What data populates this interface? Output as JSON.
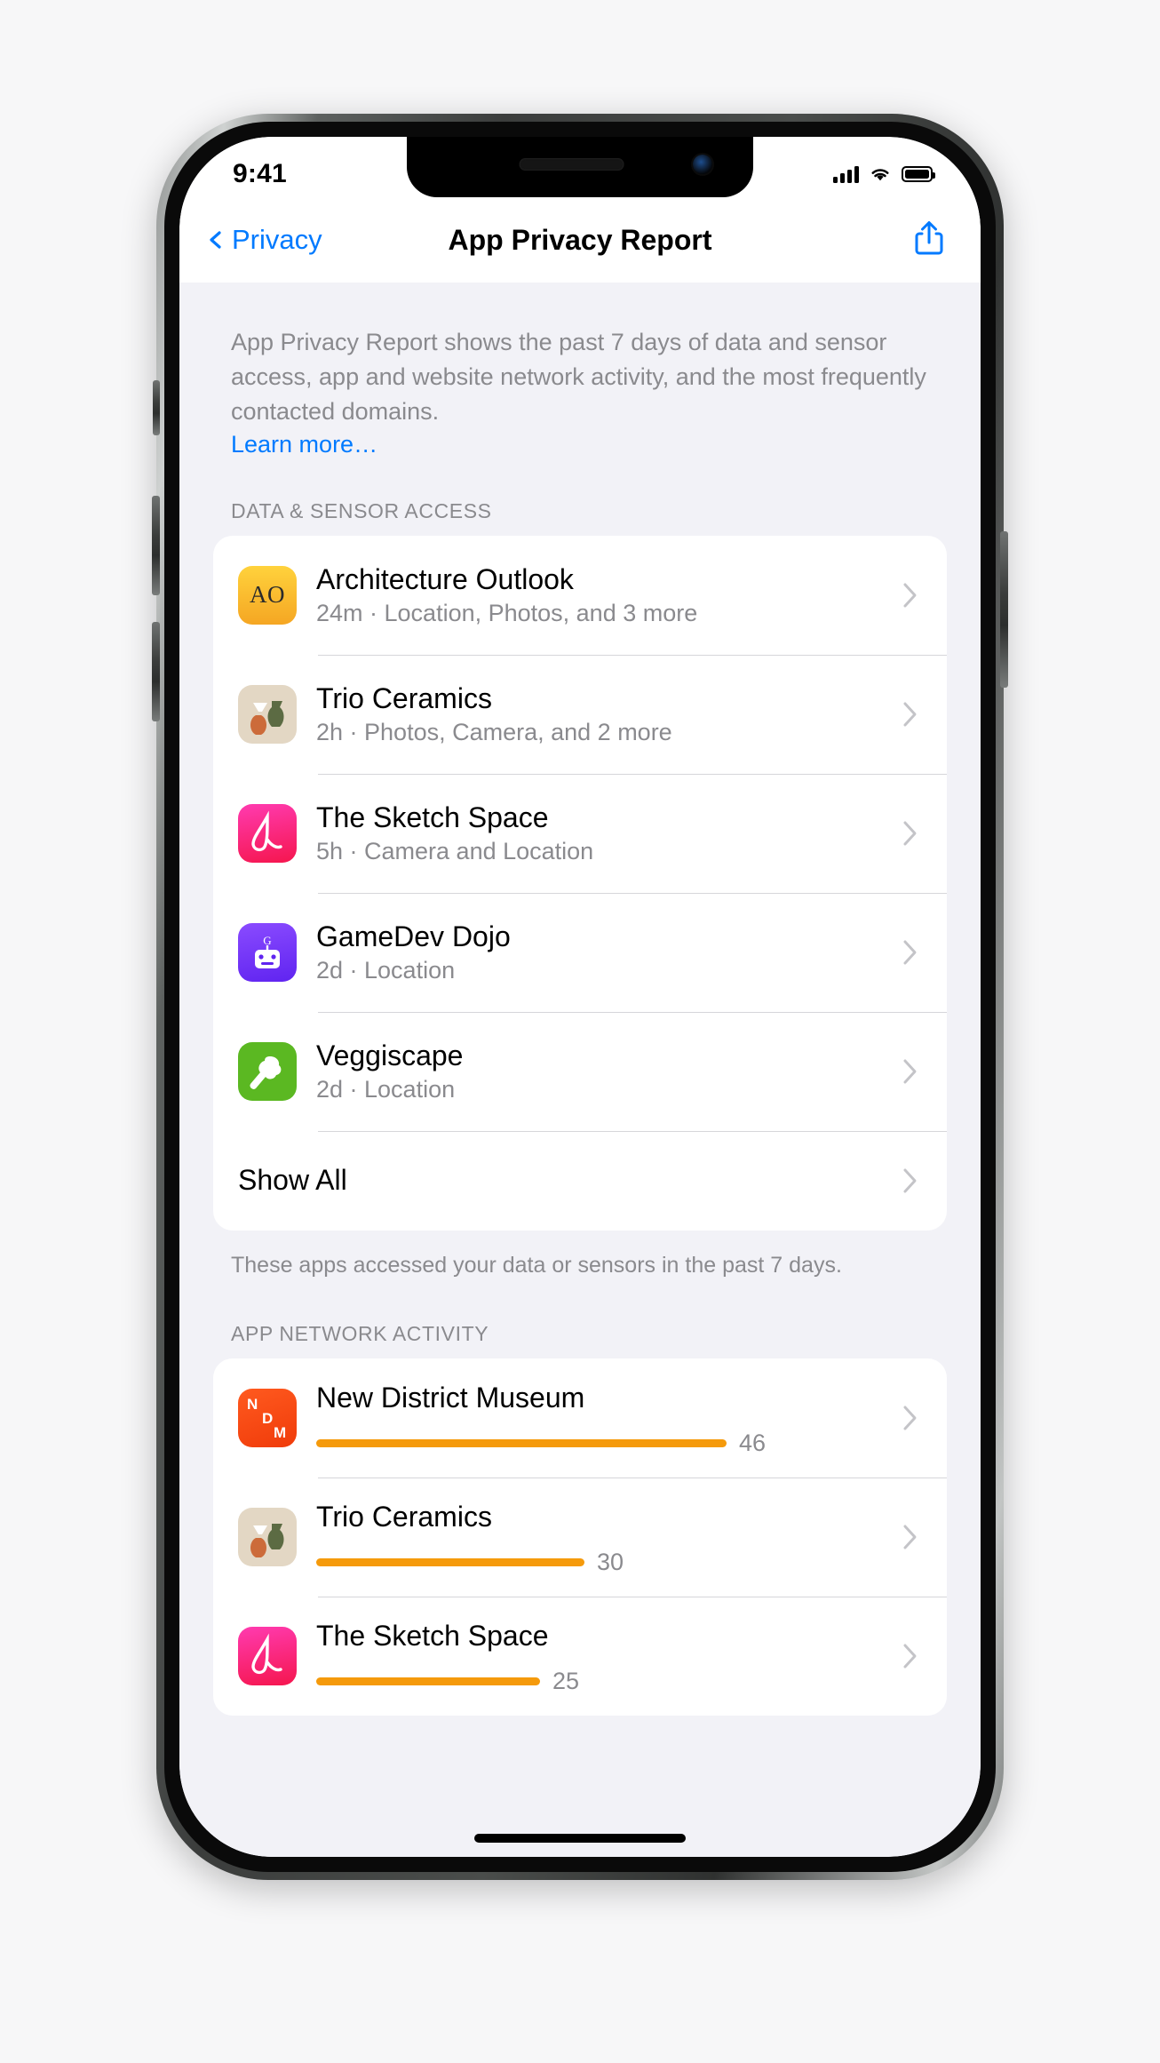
{
  "status_bar": {
    "time": "9:41",
    "cellular_icon": "cellular-signal-icon",
    "wifi_icon": "wifi-icon",
    "battery_icon": "battery-icon"
  },
  "nav": {
    "back_label": "Privacy",
    "back_icon": "chevron-left-icon",
    "title": "App Privacy Report",
    "share_icon": "share-icon"
  },
  "intro": {
    "text": "App Privacy Report shows the past 7 days of data and sensor access, app and website network activity, and the most frequently contacted domains.",
    "learn_more": "Learn more…"
  },
  "sections": [
    {
      "header": "DATA & SENSOR ACCESS",
      "footnote": "These apps accessed your data or sensors in the past 7 days.",
      "rows": [
        {
          "app": "Architecture Outlook",
          "detail": "24m · Location, Photos, and 3 more",
          "icon": "architecture-outlook-icon",
          "monogram": "AO"
        },
        {
          "app": "Trio Ceramics",
          "detail": "2h · Photos, Camera, and 2 more",
          "icon": "trio-ceramics-icon",
          "monogram": ""
        },
        {
          "app": "The Sketch Space",
          "detail": "5h · Camera and Location",
          "icon": "the-sketch-space-icon",
          "monogram": ""
        },
        {
          "app": "GameDev Dojo",
          "detail": "2d · Location",
          "icon": "gamedev-dojo-icon",
          "monogram": ""
        },
        {
          "app": "Veggiscape",
          "detail": "2d · Location",
          "icon": "veggiscape-icon",
          "monogram": ""
        }
      ],
      "show_all": "Show All"
    },
    {
      "header": "APP NETWORK ACTIVITY",
      "rows": [
        {
          "app": "New District Museum",
          "value": "46",
          "icon": "new-district-museum-icon"
        },
        {
          "app": "Trio Ceramics",
          "value": "30",
          "icon": "trio-ceramics-icon"
        },
        {
          "app": "The Sketch Space",
          "value": "25",
          "icon": "the-sketch-space-icon"
        }
      ]
    }
  ],
  "chart_data": {
    "type": "bar",
    "title": "APP NETWORK ACTIVITY",
    "categories": [
      "New District Museum",
      "Trio Ceramics",
      "The Sketch Space"
    ],
    "values": [
      46,
      30,
      25
    ],
    "xlabel": "",
    "ylabel": "",
    "ylim": [
      0,
      46
    ],
    "bar_color": "#f59a0b",
    "orientation": "horizontal",
    "grid": false,
    "legend": false
  },
  "colors": {
    "accent": "#007aff",
    "bar": "#f59a0b",
    "secondary_text": "#8a8a8e",
    "group_bg": "#f2f2f7"
  }
}
